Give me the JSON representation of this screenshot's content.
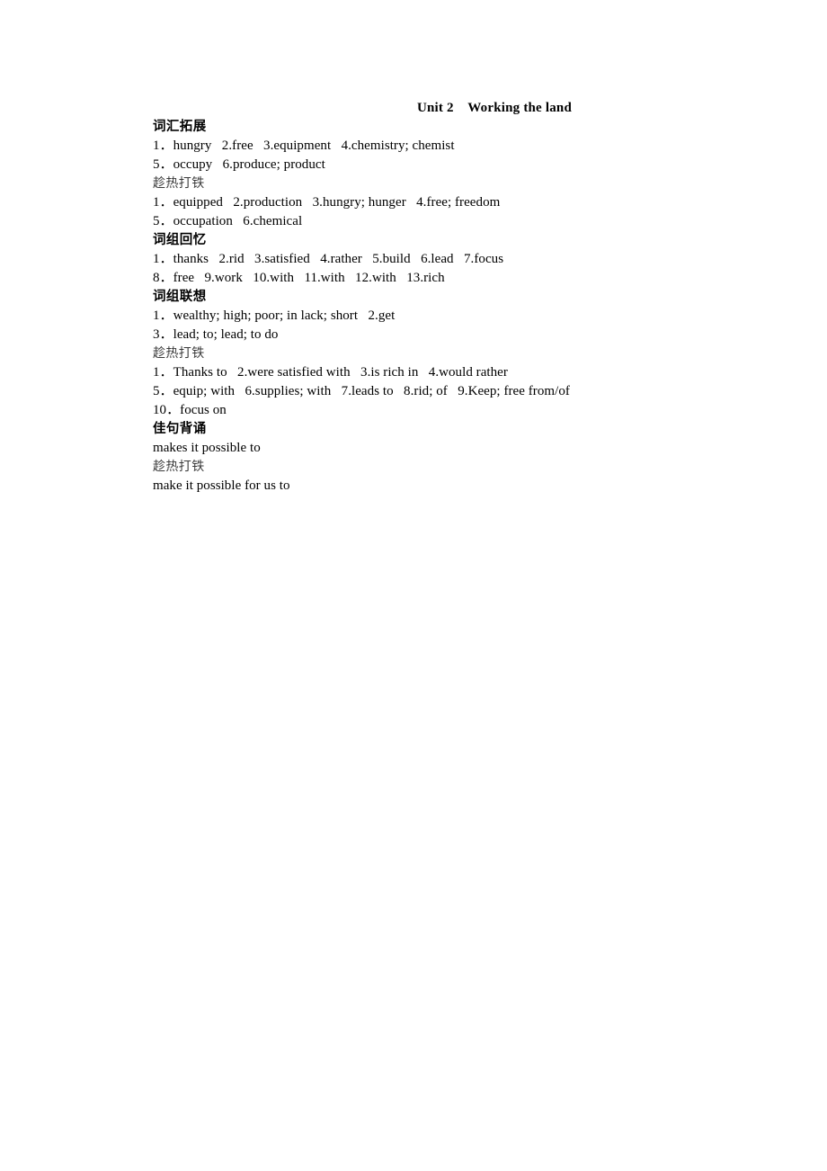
{
  "document": {
    "title": "Unit 2    Working the land",
    "blocks": [
      {
        "kind": "section-heading",
        "text": "词汇拓展"
      },
      {
        "kind": "answer-line",
        "text": "1．hungry   2.free   3.equipment   4.chemistry; chemist"
      },
      {
        "kind": "answer-line",
        "text": "5．occupy   6.produce; product"
      },
      {
        "kind": "sub-heading",
        "text": "趁热打铁"
      },
      {
        "kind": "answer-line",
        "text": "1．equipped   2.production   3.hungry; hunger   4.free; freedom"
      },
      {
        "kind": "answer-line",
        "text": "5．occupation   6.chemical"
      },
      {
        "kind": "section-heading",
        "text": "词组回忆"
      },
      {
        "kind": "answer-line",
        "text": "1．thanks   2.rid   3.satisfied   4.rather   5.build   6.lead   7.focus"
      },
      {
        "kind": "answer-line",
        "text": "8．free   9.work   10.with   11.with   12.with   13.rich"
      },
      {
        "kind": "section-heading",
        "text": "词组联想"
      },
      {
        "kind": "answer-line",
        "text": "1．wealthy; high; poor; in lack; short   2.get"
      },
      {
        "kind": "answer-line",
        "text": "3．lead; to; lead; to do"
      },
      {
        "kind": "sub-heading",
        "text": "趁热打铁"
      },
      {
        "kind": "answer-line",
        "text": "1．Thanks to   2.were satisfied with   3.is rich in   4.would rather"
      },
      {
        "kind": "answer-line",
        "text": "5．equip; with   6.supplies; with   7.leads to   8.rid; of   9.Keep; free from/of"
      },
      {
        "kind": "answer-line",
        "text": "10．focus on"
      },
      {
        "kind": "section-heading",
        "text": "佳句背诵"
      },
      {
        "kind": "answer-line",
        "text": "makes it possible to"
      },
      {
        "kind": "sub-heading",
        "text": "趁热打铁"
      },
      {
        "kind": "answer-line",
        "text": "make it possible for us to"
      }
    ]
  },
  "colors": {
    "page_background": "#ffffff",
    "body_text": "#000000",
    "sub_heading_text": "#3a3a3a"
  }
}
